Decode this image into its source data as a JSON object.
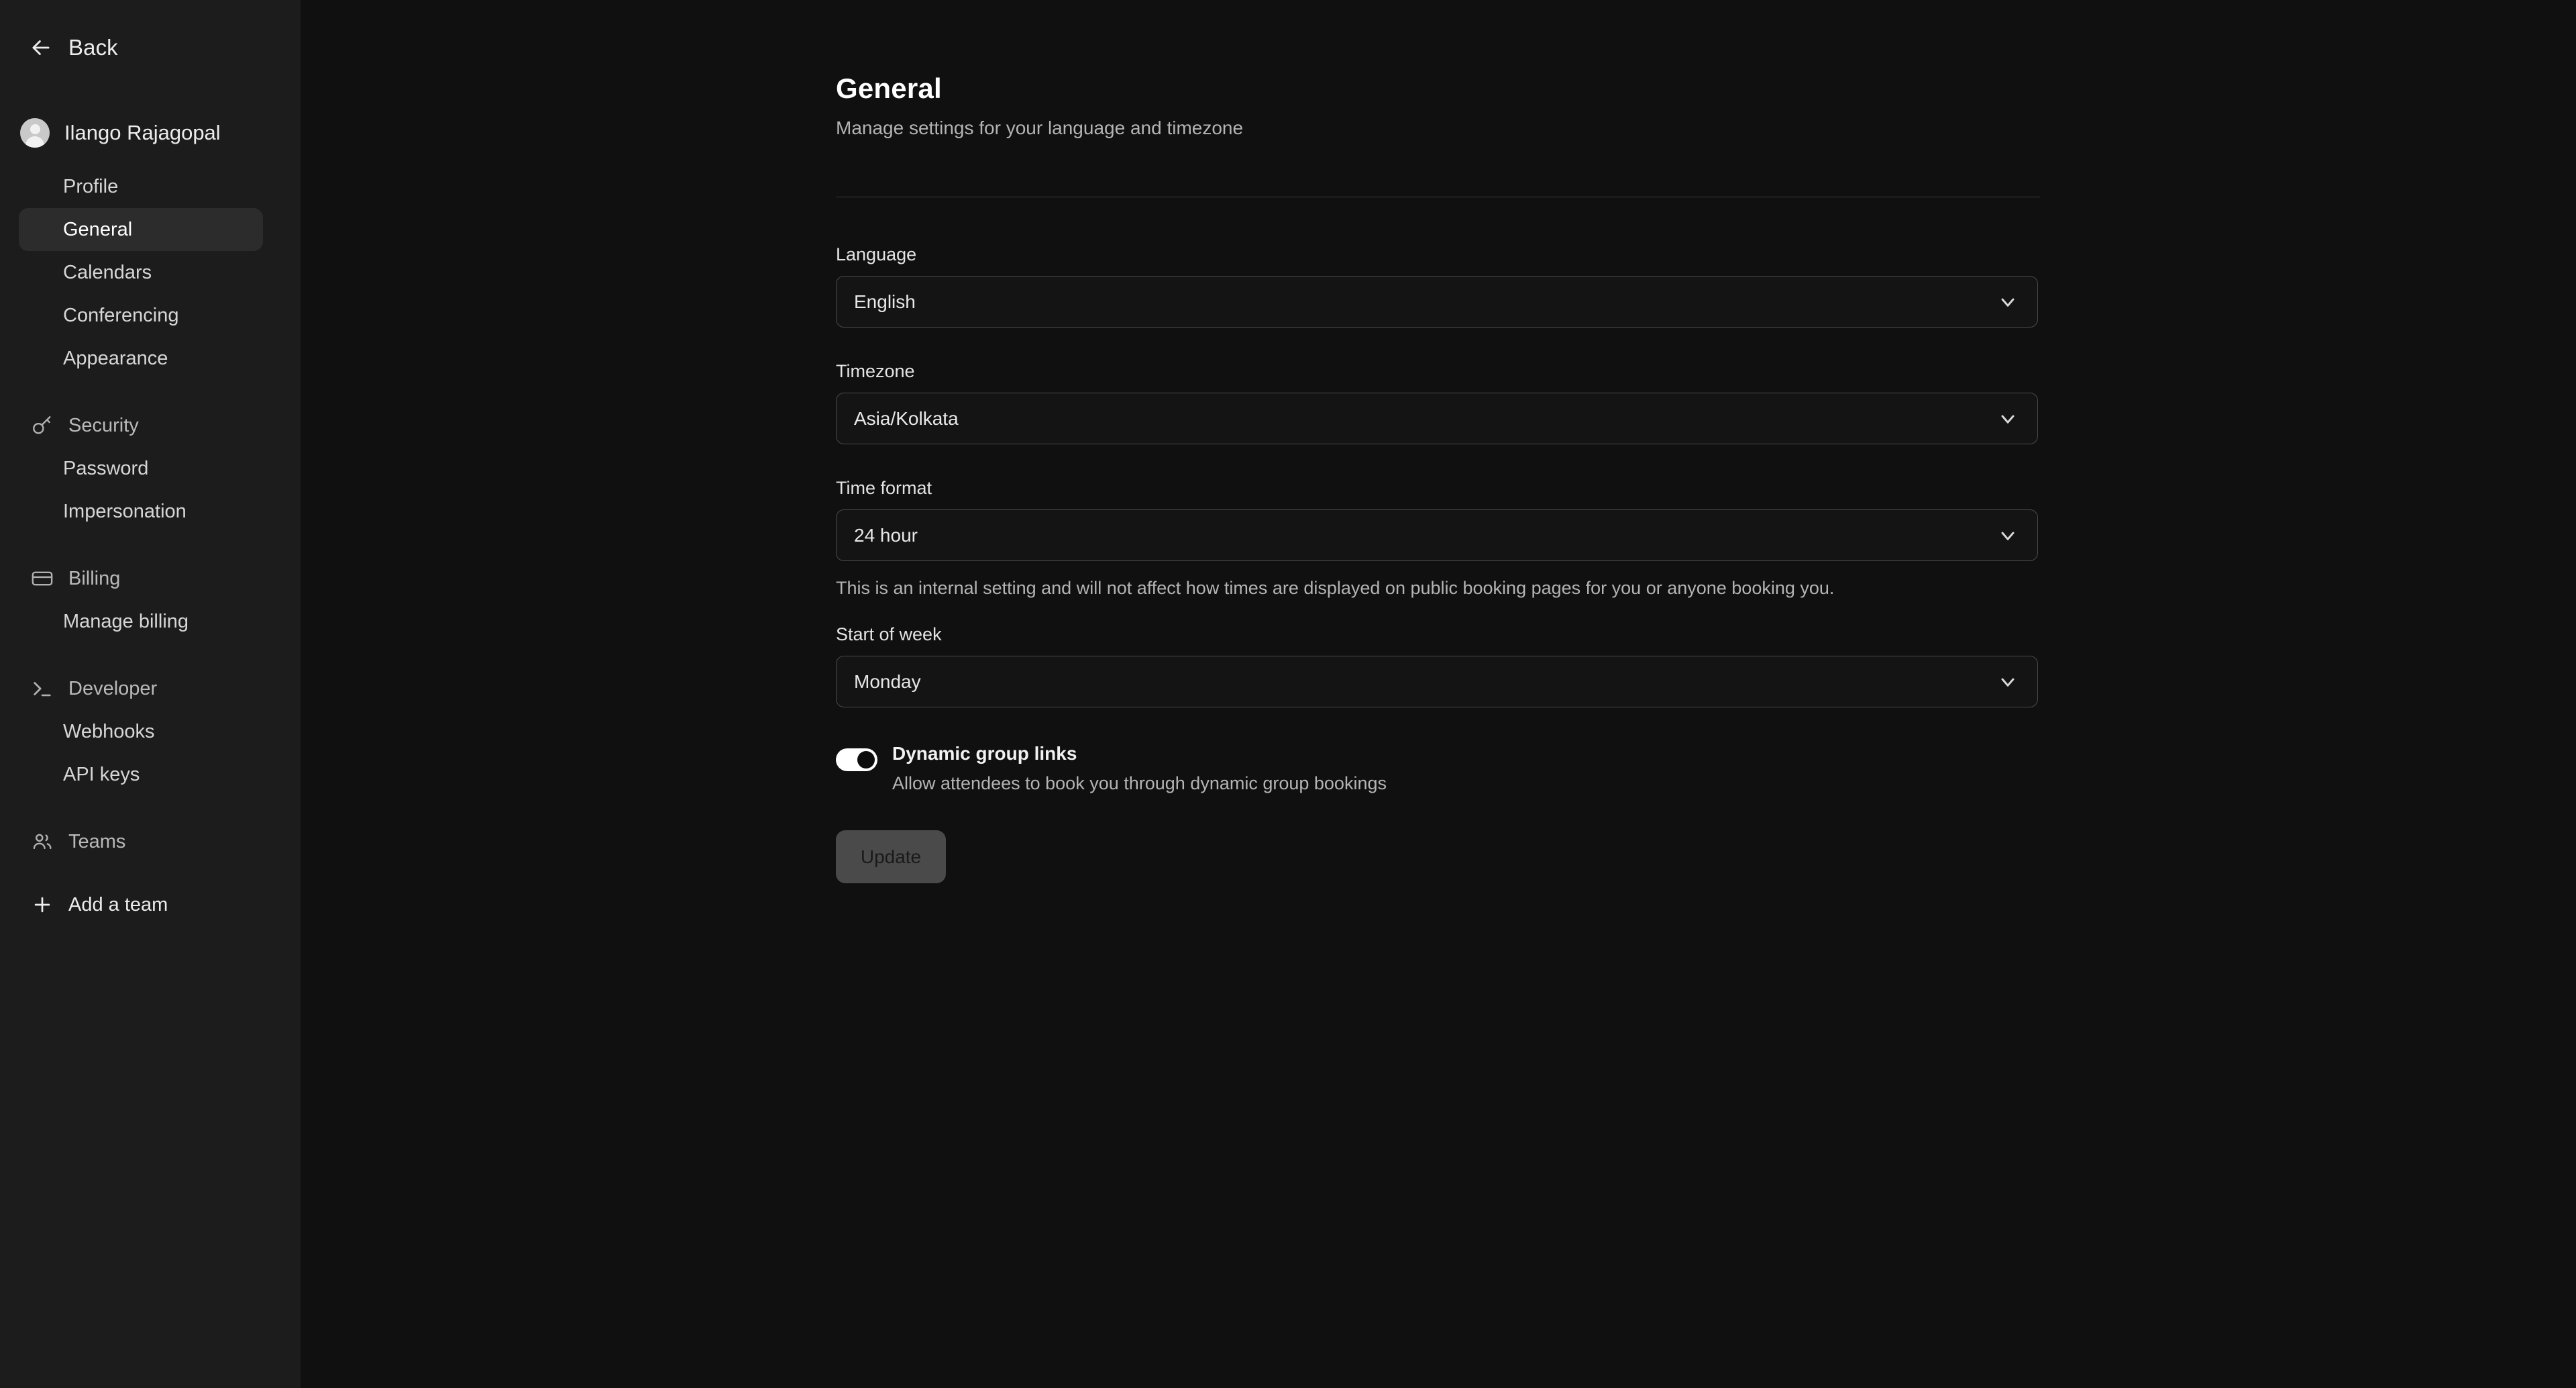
{
  "sidebar": {
    "back_label": "Back",
    "user_name": "Ilango Rajagopal",
    "user_items": [
      {
        "label": "Profile",
        "active": false
      },
      {
        "label": "General",
        "active": true
      },
      {
        "label": "Calendars",
        "active": false
      },
      {
        "label": "Conferencing",
        "active": false
      },
      {
        "label": "Appearance",
        "active": false
      }
    ],
    "groups": [
      {
        "label": "Security",
        "icon": "key-icon",
        "items": [
          {
            "label": "Password"
          },
          {
            "label": "Impersonation"
          }
        ]
      },
      {
        "label": "Billing",
        "icon": "credit-card-icon",
        "items": [
          {
            "label": "Manage billing"
          }
        ]
      },
      {
        "label": "Developer",
        "icon": "terminal-icon",
        "items": [
          {
            "label": "Webhooks"
          },
          {
            "label": "API keys"
          }
        ]
      },
      {
        "label": "Teams",
        "icon": "users-icon",
        "items": []
      }
    ],
    "add_team_label": "Add a team"
  },
  "main": {
    "title": "General",
    "subtitle": "Manage settings for your language and timezone",
    "fields": {
      "language": {
        "label": "Language",
        "value": "English"
      },
      "timezone": {
        "label": "Timezone",
        "value": "Asia/Kolkata"
      },
      "time_format": {
        "label": "Time format",
        "value": "24 hour",
        "help": "This is an internal setting and will not affect how times are displayed on public booking pages for you or anyone booking you."
      },
      "start_of_week": {
        "label": "Start of week",
        "value": "Monday"
      }
    },
    "dynamic_group_links": {
      "title": "Dynamic group links",
      "description": "Allow attendees to book you through dynamic group bookings",
      "enabled": "on"
    },
    "update_label": "Update"
  },
  "colors": {
    "sidebar_bg": "#1c1c1c",
    "main_bg": "#101010",
    "active_item_bg": "#2c2c2c",
    "border": "#4a4a4a",
    "text_primary": "#ededed",
    "text_secondary": "#b4b4b4",
    "toggle_on": "#ffffff",
    "button_disabled": "#4a4a4a"
  }
}
